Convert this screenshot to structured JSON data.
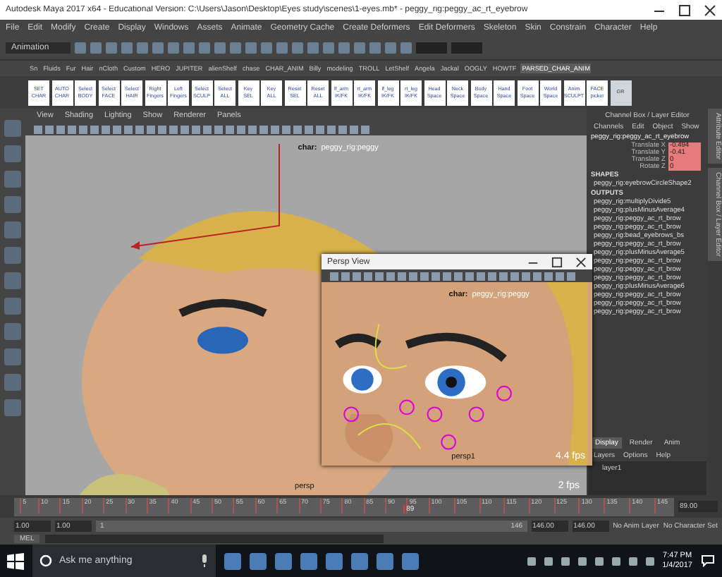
{
  "window": {
    "title": "Autodesk Maya 2017 x64 - Educational Version: C:\\Users\\Jason\\Desktop\\Eyes study\\scenes\\1-eyes.mb* - peggy_rig:peggy_ac_rt_eyebrow"
  },
  "menu": [
    "File",
    "Edit",
    "Modify",
    "Create",
    "Display",
    "Windows",
    "Assets",
    "Animate",
    "Geometry Cache",
    "Create Deformers",
    "Edit Deformers",
    "Skeleton",
    "Skin",
    "Constrain",
    "Character",
    "Help"
  ],
  "mode_menu": {
    "value": "Animation"
  },
  "shelf_tabs": [
    {
      "label": "Sn",
      "selected": false
    },
    {
      "label": "Fluids",
      "selected": false
    },
    {
      "label": "Fur",
      "selected": false
    },
    {
      "label": "Hair",
      "selected": false
    },
    {
      "label": "nCloth",
      "selected": false
    },
    {
      "label": "Custom",
      "selected": false
    },
    {
      "label": "HERO",
      "selected": false
    },
    {
      "label": "JUPITER",
      "selected": false
    },
    {
      "label": "alienShelf",
      "selected": false
    },
    {
      "label": "chase",
      "selected": false
    },
    {
      "label": "CHAR_ANIM",
      "selected": false
    },
    {
      "label": "Billy",
      "selected": false
    },
    {
      "label": "modeling",
      "selected": false
    },
    {
      "label": "TROLL",
      "selected": false
    },
    {
      "label": "LetShelf",
      "selected": false
    },
    {
      "label": "Angela",
      "selected": false
    },
    {
      "label": "Jackal",
      "selected": false
    },
    {
      "label": "OOGLY",
      "selected": false
    },
    {
      "label": "HOWTF",
      "selected": false
    },
    {
      "label": "PARSED_CHAR_ANIM",
      "selected": true
    }
  ],
  "shelf_buttons": [
    [
      "SET",
      "CHAR"
    ],
    [
      "AUTO",
      "CHAR"
    ],
    [
      "Select",
      "BODY"
    ],
    [
      "Select",
      "FACE"
    ],
    [
      "Select",
      "HAIR"
    ],
    [
      "Right",
      "Fingers"
    ],
    [
      "Left",
      "Fingers"
    ],
    [
      "Select",
      "SCULP"
    ],
    [
      "Select",
      "ALL"
    ],
    [
      "Key",
      "SEL"
    ],
    [
      "Key",
      "ALL"
    ],
    [
      "Reset",
      "SEL"
    ],
    [
      "Reset",
      "ALL"
    ],
    [
      "lf_arm",
      "IK/FK"
    ],
    [
      "rt_arm",
      "IK/FK"
    ],
    [
      "lf_leg",
      "IK/FK"
    ],
    [
      "rt_leg",
      "IK/FK"
    ],
    [
      "Head",
      "Space"
    ],
    [
      "Neck",
      "Space"
    ],
    [
      "Body",
      "Space"
    ],
    [
      "Hand",
      "Space"
    ],
    [
      "Foot",
      "Space"
    ],
    [
      "World",
      "Space"
    ],
    [
      "Anim",
      "SCULPT"
    ],
    [
      "FACE",
      "picker"
    ]
  ],
  "shelf_last": "GR",
  "panel_menu": [
    "View",
    "Shading",
    "Lighting",
    "Show",
    "Renderer",
    "Panels"
  ],
  "viewport": {
    "hud_char": "char:",
    "hud_name": "peggy_rig:peggy",
    "camera": "persp",
    "fps": "2 fps"
  },
  "persp_window": {
    "title": "Persp View",
    "hud_char": "char:",
    "hud_name": "peggy_rig:peggy",
    "camera": "persp1",
    "fps": "4.4 fps"
  },
  "channel_box": {
    "title": "Channel Box / Layer Editor",
    "menu": [
      "Channels",
      "Edit",
      "Object",
      "Show"
    ],
    "object": "peggy_rig:peggy_ac_rt_eyebrow",
    "channels": [
      {
        "name": "Translate X",
        "value": "-0.494",
        "keyed": true
      },
      {
        "name": "Translate Y",
        "value": "-0.41",
        "keyed": true
      },
      {
        "name": "Translate Z",
        "value": "0",
        "keyed": true
      },
      {
        "name": "Rotate Z",
        "value": "0",
        "keyed": true
      }
    ],
    "shapes_heading": "SHAPES",
    "shapes": [
      "peggy_rig:eyebrowCircleShape2"
    ],
    "outputs_heading": "OUTPUTS",
    "outputs": [
      "peggy_rig:multiplyDivide5",
      "peggy_rig:plusMinusAverage4",
      "peggy_rig:peggy_ac_rt_brow",
      "peggy_rig:peggy_ac_rt_brow",
      "peggy_rig:bead_eyebrows_bs",
      "peggy_rig:peggy_ac_rt_brow",
      "peggy_rig:plusMinusAverage5",
      "peggy_rig:peggy_ac_rt_brow",
      "peggy_rig:peggy_ac_rt_brow",
      "peggy_rig:peggy_ac_rt_brow",
      "peggy_rig:plusMinusAverage6",
      "peggy_rig:peggy_ac_rt_brow",
      "peggy_rig:peggy_ac_rt_brow",
      "peggy_rig:peggy_ac_rt_brow"
    ]
  },
  "side_tabs": [
    "Attribute Editor",
    "Channel Box / Layer Editor"
  ],
  "layer_editor": {
    "tabs": [
      {
        "label": "Display",
        "selected": true
      },
      {
        "label": "Render",
        "selected": false
      },
      {
        "label": "Anim",
        "selected": false
      }
    ],
    "menu": [
      "Layers",
      "Options",
      "Help"
    ],
    "layers": [
      "layer1"
    ]
  },
  "time_slider": {
    "ticks": [
      "5",
      "10",
      "15",
      "20",
      "25",
      "30",
      "35",
      "40",
      "45",
      "50",
      "55",
      "60",
      "65",
      "70",
      "75",
      "80",
      "85",
      "90",
      "95",
      "100",
      "105",
      "110",
      "115",
      "120",
      "125",
      "130",
      "135",
      "140",
      "145"
    ],
    "current": "89",
    "level": 0.59,
    "current_field": "89.00"
  },
  "range": {
    "level": 1,
    "start": "1.00",
    "min": "1.00",
    "bar_start": "1",
    "bar_end": "146",
    "max": "146.00",
    "end": "146.00",
    "anim_layer": "No Anim Layer",
    "character_set": "No Character Set"
  },
  "command_line": {
    "label": "MEL"
  },
  "taskbar": {
    "search_placeholder": "Ask me anything",
    "time": "7:47 PM",
    "date": "1/4/2017"
  }
}
